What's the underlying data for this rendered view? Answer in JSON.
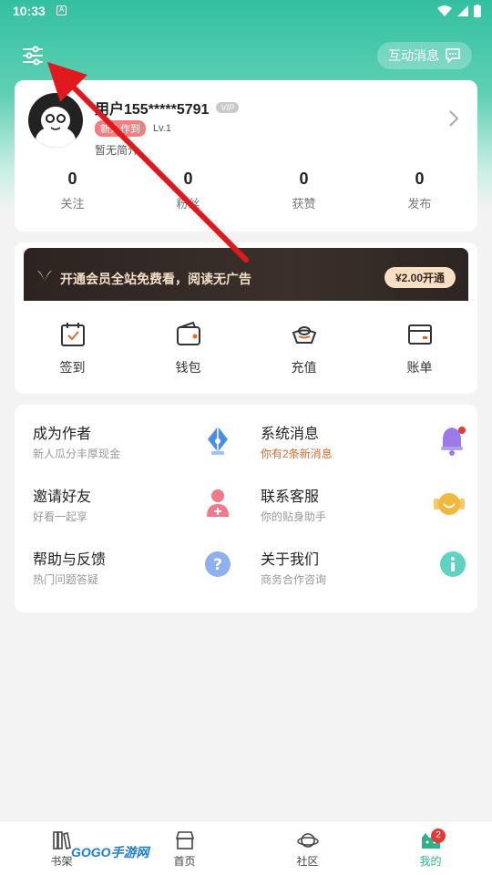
{
  "status": {
    "time": "10:33"
  },
  "header": {
    "message_label": "互动消息"
  },
  "profile": {
    "username": "用户155*****5791",
    "vip_tag": "VIP",
    "new_badge": "新人作到",
    "level": "Lv.1",
    "bio": "暂无简介",
    "stats": [
      {
        "value": "0",
        "label": "关注"
      },
      {
        "value": "0",
        "label": "粉丝"
      },
      {
        "value": "0",
        "label": "获赞"
      },
      {
        "value": "0",
        "label": "发布"
      }
    ]
  },
  "vip": {
    "text": "开通会员全站免费看，阅读无广告",
    "button": "¥2.00开通"
  },
  "quick": [
    {
      "label": "签到",
      "icon": "calendar-check-icon"
    },
    {
      "label": "钱包",
      "icon": "wallet-icon"
    },
    {
      "label": "充值",
      "icon": "ingot-icon"
    },
    {
      "label": "账单",
      "icon": "card-icon"
    }
  ],
  "menu": [
    {
      "title": "成为作者",
      "subtitle": "新人瓜分丰厚现金",
      "icon": "pen-nib-icon"
    },
    {
      "title": "系统消息",
      "subtitle": "你有2条新消息",
      "icon": "bell-icon"
    },
    {
      "title": "邀请好友",
      "subtitle": "好看一起享",
      "icon": "add-user-icon"
    },
    {
      "title": "联系客服",
      "subtitle": "你的贴身助手",
      "icon": "headset-icon"
    },
    {
      "title": "帮助与反馈",
      "subtitle": "热门问题答疑",
      "icon": "question-icon"
    },
    {
      "title": "关于我们",
      "subtitle": "商务合作咨询",
      "icon": "info-icon"
    }
  ],
  "tabs": [
    {
      "label": "书架"
    },
    {
      "label": "首页"
    },
    {
      "label": "社区"
    },
    {
      "label": "我的",
      "badge": "2"
    }
  ],
  "watermark": "GOGO手游网",
  "colors": {
    "accent": "#2bb38c",
    "arrow": "#e0191e",
    "highlight": "#e0692d"
  }
}
